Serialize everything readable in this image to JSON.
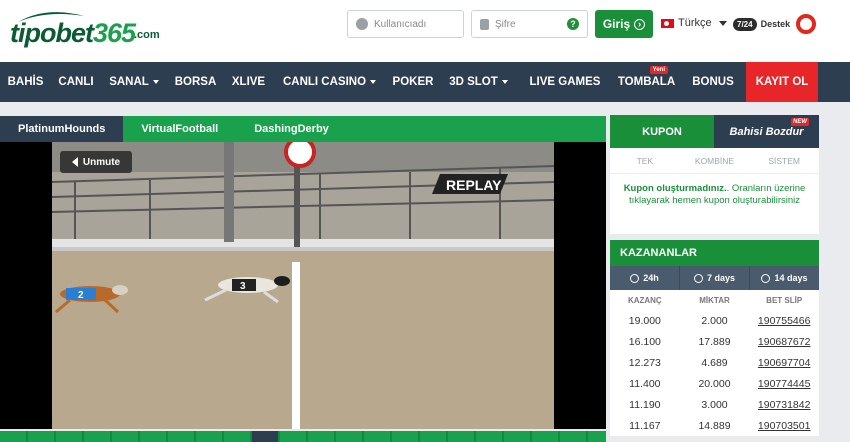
{
  "brand": {
    "name_part1": "tipobet",
    "name_part2": "365",
    "domain": ".com"
  },
  "login": {
    "username_placeholder": "Kullanıcıadı",
    "password_placeholder": "Şifre",
    "help_icon_text": "?",
    "login_button": "Giriş"
  },
  "language": {
    "label": "Türkçe"
  },
  "support": {
    "badge": "7/24",
    "label": "Destek"
  },
  "nav": {
    "items": [
      {
        "label": "BAHİS",
        "dropdown": false
      },
      {
        "label": "CANLI",
        "dropdown": false
      },
      {
        "label": "SANAL",
        "dropdown": true
      },
      {
        "label": "BORSA",
        "dropdown": false
      },
      {
        "label": "XLIVE",
        "dropdown": false
      },
      {
        "label": "CANLI CASINO",
        "dropdown": true
      },
      {
        "label": "POKER",
        "dropdown": false
      },
      {
        "label": "3D SLOT",
        "dropdown": true
      },
      {
        "label": "LIVE GAMES",
        "dropdown": false
      },
      {
        "label": "TOMBALA",
        "dropdown": false,
        "badge": "Yeni"
      },
      {
        "label": "BONUS",
        "dropdown": false
      },
      {
        "label": "KAYIT OL",
        "dropdown": false
      }
    ]
  },
  "game_tabs": [
    "PlatinumHounds",
    "VirtualFootball",
    "DashingDerby"
  ],
  "video": {
    "unmute_label": "Unmute",
    "replay_label": "REPLAY",
    "dog_numbers": [
      "2",
      "3"
    ]
  },
  "coupon": {
    "tab_kupon": "KUPON",
    "tab_bahisi_bozdur": "Bahisi Bozdur",
    "new_badge": "NEW",
    "subtabs": [
      "TEK",
      "KOMBİNE",
      "SİSTEM"
    ],
    "message_bold": "Kupon oluşturmadınız.",
    "message_rest": ". Oranların üzerine tıklayarak hemen kupon oluşturabilirsiniz"
  },
  "winners": {
    "title": "KAZANANLAR",
    "filters": [
      "24h",
      "7 days",
      "14 days"
    ],
    "columns": [
      "KAZANÇ",
      "MİKTAR",
      "BET SLİP"
    ],
    "rows": [
      {
        "kazanc": "19.000",
        "miktar": "2.000",
        "slip": "190755466"
      },
      {
        "kazanc": "16.100",
        "miktar": "17.889",
        "slip": "190687672"
      },
      {
        "kazanc": "12.273",
        "miktar": "4.689",
        "slip": "190697704"
      },
      {
        "kazanc": "11.400",
        "miktar": "20.000",
        "slip": "190774445"
      },
      {
        "kazanc": "11.190",
        "miktar": "3.000",
        "slip": "190731842"
      },
      {
        "kazanc": "11.167",
        "miktar": "14.889",
        "slip": "190703501"
      }
    ]
  },
  "colors": {
    "green": "#1a8f3a",
    "navy": "#2c3e50",
    "red": "#e8262a"
  }
}
